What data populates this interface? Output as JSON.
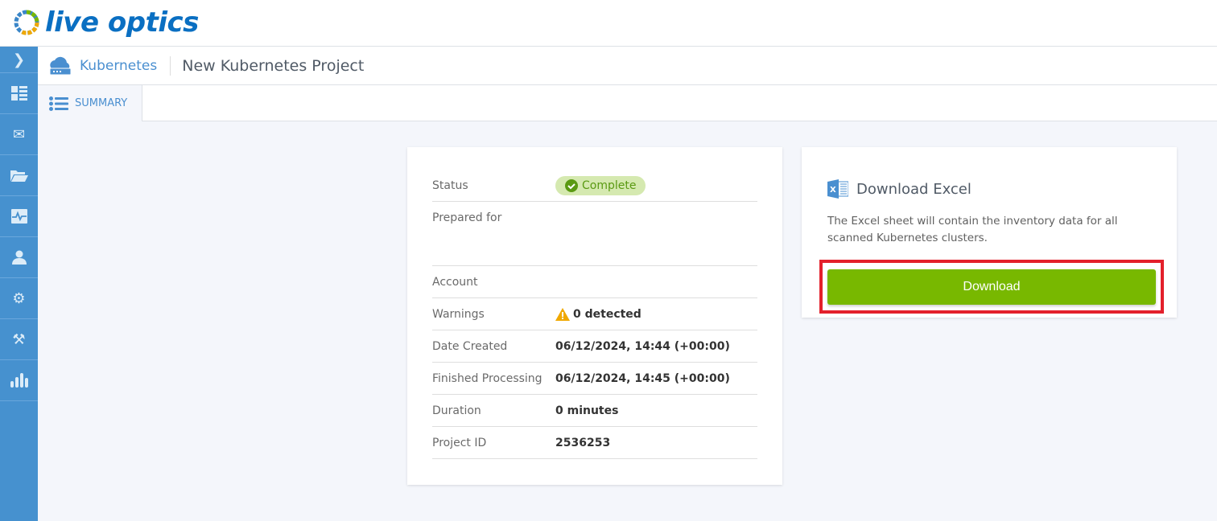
{
  "app": {
    "logo_text": "live optics"
  },
  "sidebar": {
    "items": [
      "expand",
      "dashboard",
      "messages",
      "projects",
      "monitoring",
      "profile",
      "settings",
      "tools",
      "reports"
    ]
  },
  "header": {
    "product": "Kubernetes",
    "project_title": "New Kubernetes Project"
  },
  "tabs": [
    {
      "label": "SUMMARY",
      "active": true
    }
  ],
  "summary": {
    "status_label": "Status",
    "status_value": "Complete",
    "prepared_for_label": "Prepared for",
    "prepared_for_value": "",
    "account_label": "Account",
    "account_value": "",
    "warnings_label": "Warnings",
    "warnings_value": "0 detected",
    "date_created_label": "Date Created",
    "date_created_value": "06/12/2024, 14:44 (+00:00)",
    "finished_label": "Finished Processing",
    "finished_value": "06/12/2024, 14:45 (+00:00)",
    "duration_label": "Duration",
    "duration_value": "0 minutes",
    "project_id_label": "Project ID",
    "project_id_value": "2536253"
  },
  "download": {
    "title": "Download Excel",
    "description": "The Excel sheet will contain the inventory data for all scanned Kubernetes clusters.",
    "button_label": "Download"
  },
  "colors": {
    "sidebar": "#4691cf",
    "button": "#78b800",
    "highlight": "#e3202b"
  }
}
